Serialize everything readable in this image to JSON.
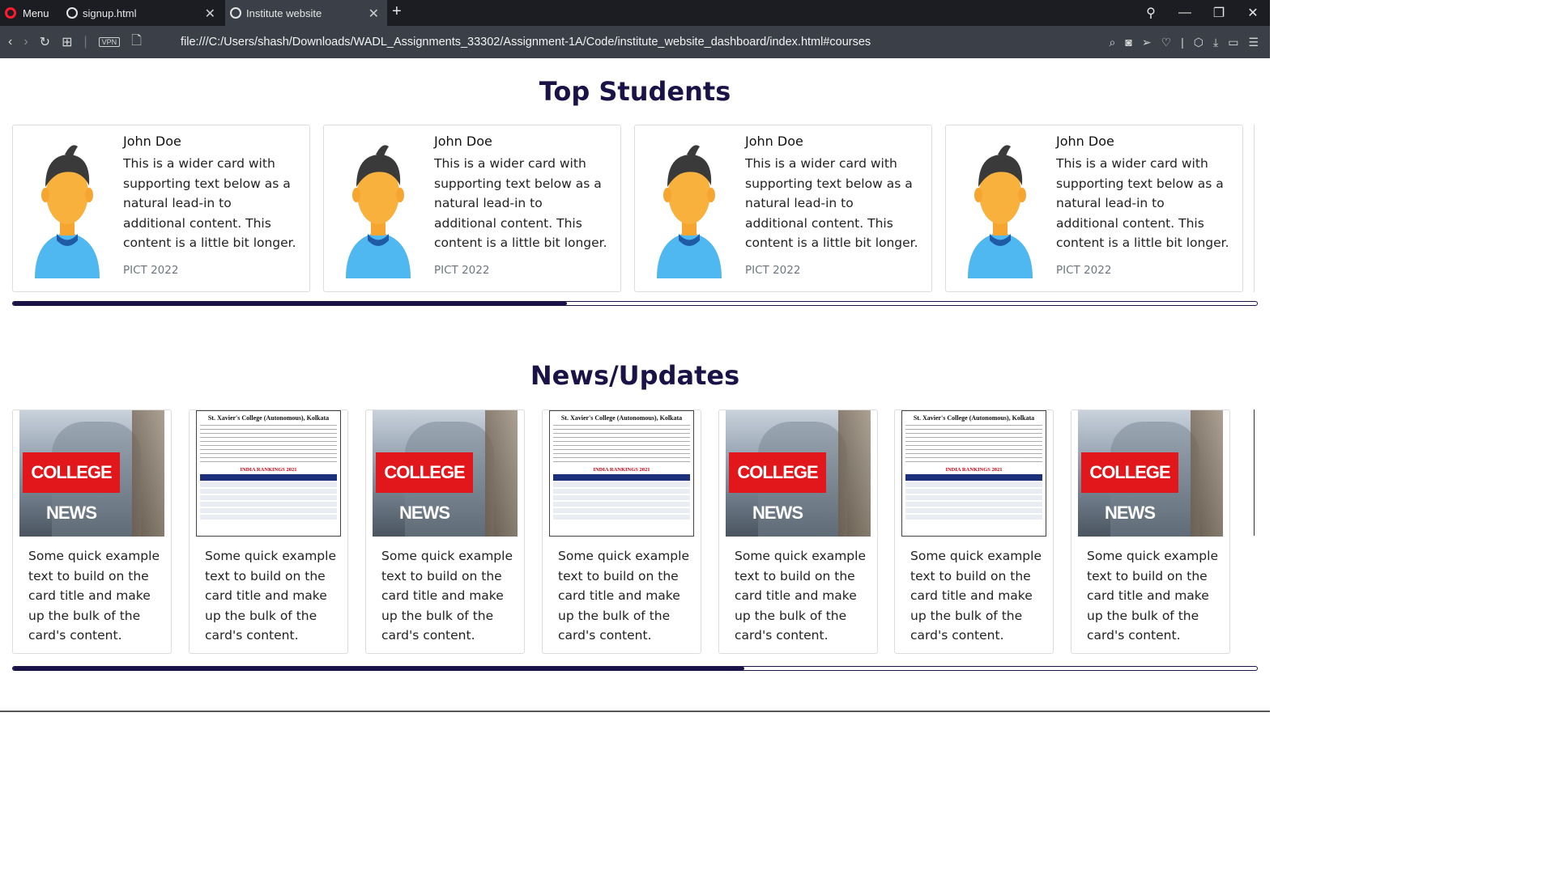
{
  "browser": {
    "menu_label": "Menu",
    "tabs": [
      {
        "title": "signup.html"
      },
      {
        "title": "Institute website"
      }
    ],
    "new_tab_symbol": "+",
    "vpn_label": "VPN",
    "url": "file:///C:/Users/shash/Downloads/WADL_Assignments_33302/Assignment-1A/Code/institute_website_dashboard/index.html#courses"
  },
  "top_students": {
    "title": "Top Students",
    "scroll_progress": 0.445,
    "cards": [
      {
        "name": "John Doe",
        "text": "This is a wider card with supporting text below as a natural lead-in to additional content. This content is a little bit longer.",
        "footer": "PICT 2022"
      },
      {
        "name": "John Doe",
        "text": "This is a wider card with supporting text below as a natural lead-in to additional content. This content is a little bit longer.",
        "footer": "PICT 2022"
      },
      {
        "name": "John Doe",
        "text": "This is a wider card with supporting text below as a natural lead-in to additional content. This content is a little bit longer.",
        "footer": "PICT 2022"
      },
      {
        "name": "John Doe",
        "text": "This is a wider card with supporting text below as a natural lead-in to additional content. This content is a little bit longer.",
        "footer": "PICT 2022"
      }
    ]
  },
  "news": {
    "title": "News/Updates",
    "scroll_progress": 0.588,
    "college_news_label": "COLLEGE NEWS",
    "ranking_header": "St. Xavier's College (Autonomous), Kolkata",
    "ranking_subheader": "INDIA RANKINGS 2021",
    "cards": [
      {
        "image": "college-news",
        "text": "Some quick example text to build on the card title and make up the bulk of the card's content."
      },
      {
        "image": "ranking",
        "text": "Some quick example text to build on the card title and make up the bulk of the card's content."
      },
      {
        "image": "college-news",
        "text": "Some quick example text to build on the card title and make up the bulk of the card's content."
      },
      {
        "image": "ranking",
        "text": "Some quick example text to build on the card title and make up the bulk of the card's content."
      },
      {
        "image": "college-news",
        "text": "Some quick example text to build on the card title and make up the bulk of the card's content."
      },
      {
        "image": "ranking",
        "text": "Some quick example text to build on the card title and make up the bulk of the card's content."
      },
      {
        "image": "college-news",
        "text": "Some quick example text to build on the card title and make up the bulk of the card's content."
      }
    ]
  },
  "colors": {
    "heading": "#1a1347",
    "tabbar_bg": "#1b1d22",
    "addressbar_bg": "#3b4048",
    "opera_red": "#ff1b2d",
    "news_banner": "#e2171c"
  }
}
